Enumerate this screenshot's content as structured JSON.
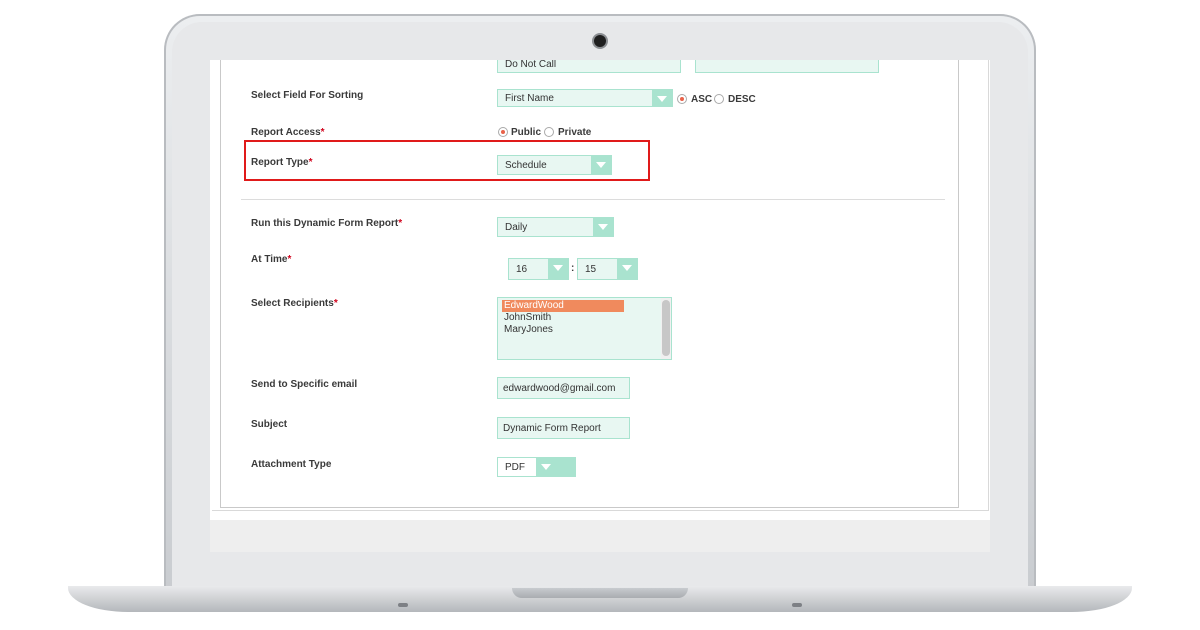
{
  "form": {
    "top_partial_value": "Do Not Call",
    "sorting": {
      "label": "Select Field For Sorting",
      "field": "First Name",
      "asc_label": "ASC",
      "desc_label": "DESC",
      "selected": "ASC"
    },
    "access": {
      "label": "Report Access",
      "required": "*",
      "public_label": "Public",
      "private_label": "Private",
      "selected": "Public"
    },
    "report_type": {
      "label": "Report Type",
      "required": "*",
      "value": "Schedule"
    },
    "run_frequency": {
      "label": "Run this Dynamic Form Report",
      "required": "*",
      "value": "Daily"
    },
    "at_time": {
      "label": "At Time",
      "required": "*",
      "hour": "16",
      "separator": ":",
      "minute": "15"
    },
    "recipients": {
      "label": "Select Recipients",
      "required": "*",
      "options": [
        "EdwardWood",
        "JohnSmith",
        "MaryJones"
      ],
      "selected": "EdwardWood"
    },
    "specific_email": {
      "label": "Send to Specific email",
      "value": "edwardwood@gmail.com"
    },
    "subject": {
      "label": "Subject",
      "value": "Dynamic Form Report"
    },
    "attachment": {
      "label": "Attachment Type",
      "value": "PDF"
    }
  },
  "colors": {
    "accent": "#a9e3cf",
    "field_bg": "#e8f7f2",
    "highlight": "#e01a1a",
    "selected_option": "#f08a5d",
    "radio_on": "#e8624a"
  },
  "icons": [
    "chevron-down-icon",
    "camera-icon"
  ]
}
